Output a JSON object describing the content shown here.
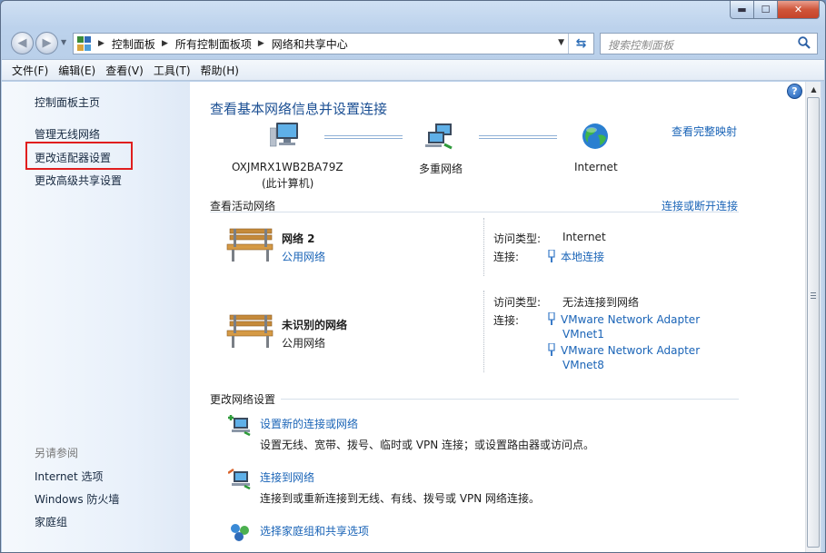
{
  "window": {
    "caption_min": "▬",
    "caption_max": "☐",
    "caption_close": "✕"
  },
  "address": {
    "crumbs": [
      "控制面板",
      "所有控制面板项",
      "网络和共享中心"
    ],
    "search_placeholder": "搜索控制面板"
  },
  "menu": [
    "文件(F)",
    "编辑(E)",
    "查看(V)",
    "工具(T)",
    "帮助(H)"
  ],
  "sidebar": {
    "items": [
      "控制面板主页",
      "管理无线网络",
      "更改适配器设置",
      "更改高级共享设置"
    ],
    "see_also_label": "另请参阅",
    "see_also": [
      "Internet 选项",
      "Windows 防火墙",
      "家庭组"
    ]
  },
  "main": {
    "title": "查看基本网络信息并设置连接",
    "full_map_link": "查看完整映射",
    "map": {
      "computer_name": "OXJMRX1WB2BA79Z",
      "computer_sub": "(此计算机)",
      "middle": "多重网络",
      "internet": "Internet"
    },
    "active_header": "查看活动网络",
    "connect_link": "连接或断开连接",
    "networks": [
      {
        "name": "网络  2",
        "type": "公用网络",
        "access_label": "访问类型:",
        "access_value": "Internet",
        "conn_label": "连接:",
        "conn_values": [
          "本地连接"
        ]
      },
      {
        "name": "未识别的网络",
        "type": "公用网络",
        "access_label": "访问类型:",
        "access_value": "无法连接到网络",
        "conn_label": "连接:",
        "conn_values": [
          "VMware Network Adapter",
          "VMnet1",
          "VMware Network Adapter",
          "VMnet8"
        ]
      }
    ],
    "change_header": "更改网络设置",
    "tasks": [
      {
        "link": "设置新的连接或网络",
        "desc": "设置无线、宽带、拨号、临时或 VPN 连接；或设置路由器或访问点。"
      },
      {
        "link": "连接到网络",
        "desc": "连接到或重新连接到无线、有线、拨号或 VPN 网络连接。"
      },
      {
        "link": "选择家庭组和共享选项",
        "desc": ""
      }
    ]
  },
  "colors": {
    "link": "#1a64b7",
    "title": "#1b4f93",
    "highlight_box": "#e01e1e"
  }
}
